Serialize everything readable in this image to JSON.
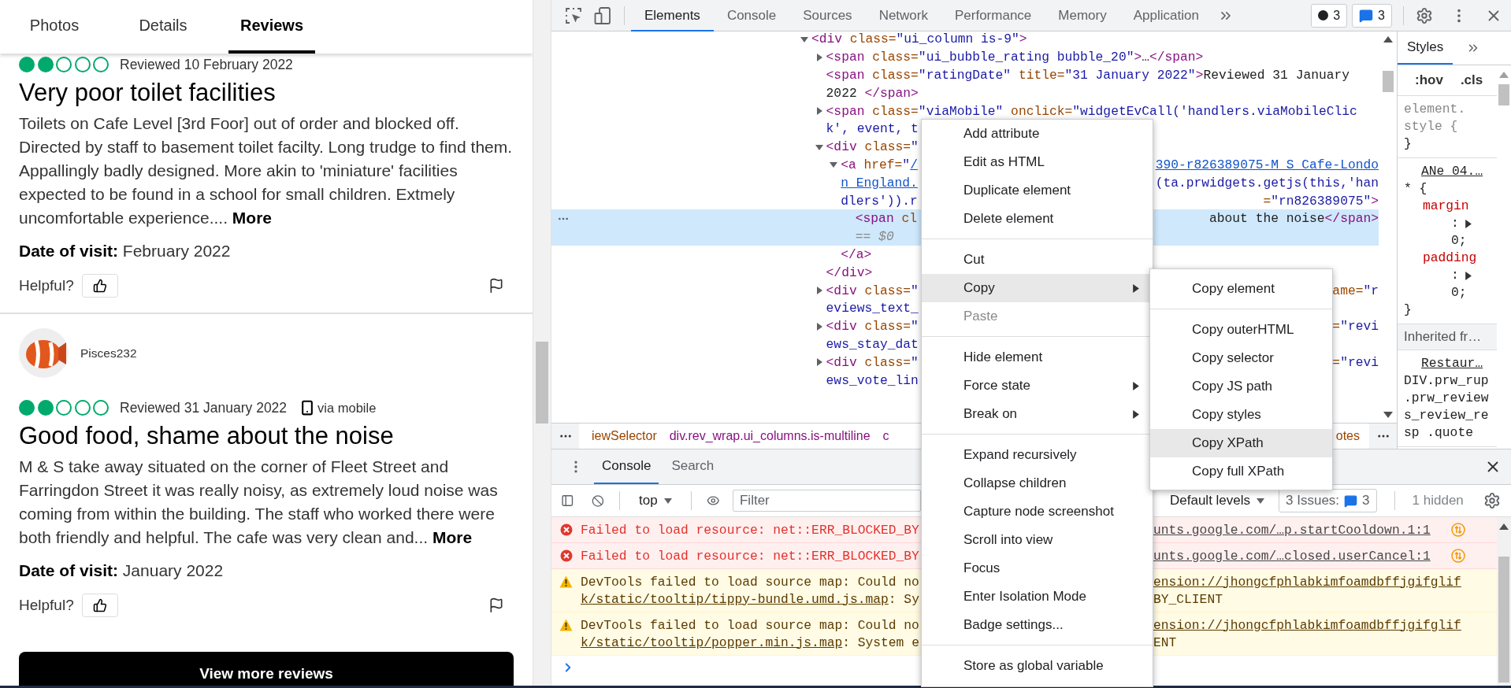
{
  "page": {
    "tabs": [
      {
        "label": "Photos",
        "selected": false
      },
      {
        "label": "Details",
        "selected": false
      },
      {
        "label": "Reviews",
        "selected": true
      }
    ],
    "reviews": [
      {
        "stars": 2,
        "date": "Reviewed 10 February 2022",
        "title": "Very poor toilet facilities",
        "body": "Toilets on Cafe Level [3rd Foor] out of order and blocked off. Directed by staff to basement toilet facilty. Long trudge to find them. Appallingly badly designed. More akin to 'miniature' facilities expected to be found in a school for small children. Extmely uncomfortable experience....",
        "more": "More",
        "visit": "**Date of visit:** February 2022",
        "helpful": "Helpful?"
      },
      {
        "author": "Pisces232",
        "stars": 2,
        "date": "Reviewed 31 January 2022",
        "via": "via mobile",
        "title": "Good food, shame about the noise",
        "body": "M & S take away situated on the corner of Fleet Street and Farringdon Street it was really noisy, as extremely loud noise was coming from within the building. The staff who worked there were both friendly and helpful. The cafe was very clean and...",
        "more": "More",
        "visit": "**Date of visit:** January 2022",
        "helpful": "Helpful?"
      }
    ],
    "view_more": "View more reviews"
  },
  "devtools": {
    "toolbar": {
      "tabs": [
        {
          "label": "Elements",
          "selected": true
        },
        {
          "label": "Console",
          "selected": false
        },
        {
          "label": "Sources",
          "selected": false
        },
        {
          "label": "Network",
          "selected": false
        },
        {
          "label": "Performance",
          "selected": false
        },
        {
          "label": "Memory",
          "selected": false
        },
        {
          "label": "Application",
          "selected": false
        }
      ],
      "errors": "3",
      "messages": "3"
    },
    "tree": {
      "kind": "element",
      "expanded": true,
      "selected": false,
      "lines": [
        {
          "left": [
            {
              "kind": "tag",
              "text": "<div"
            },
            {
              "kind": "attr",
              "text": " class="
            },
            {
              "kind": "value",
              "text": "\"ui_column is-9\""
            },
            {
              "kind": "tag",
              "text": ">"
            }
          ]
        }
      ],
      "children": [
        {
          "kind": "element",
          "expanded": false,
          "selected": false,
          "lines": [
            {
              "left": [
                {
                  "kind": "tag",
                  "text": "<span"
                },
                {
                  "kind": "attr",
                  "text": " class="
                },
                {
                  "kind": "value",
                  "text": "\"ui_bubble_rating bubble_20\""
                },
                {
                  "kind": "tag",
                  "text": ">"
                },
                {
                  "kind": "text",
                  "text": "…"
                },
                {
                  "kind": "tag",
                  "text": "</span>"
                }
              ]
            }
          ]
        },
        {
          "kind": "leaf",
          "selected": false,
          "lines": [
            {
              "left": [
                {
                  "kind": "tag",
                  "text": "<span"
                },
                {
                  "kind": "attr",
                  "text": " class="
                },
                {
                  "kind": "value",
                  "text": "\"ratingDate\""
                },
                {
                  "kind": "attr",
                  "text": " title="
                },
                {
                  "kind": "value",
                  "text": "\"31 January 2022\""
                },
                {
                  "kind": "tag",
                  "text": ">"
                },
                {
                  "kind": "text",
                  "text": "Reviewed 31 January"
                }
              ]
            },
            {
              "left": [
                {
                  "kind": "text",
                  "text": "2022 "
                },
                {
                  "kind": "tag",
                  "text": "</span>"
                }
              ]
            }
          ]
        },
        {
          "kind": "element",
          "expanded": false,
          "selected": false,
          "lines": [
            {
              "left": [
                {
                  "kind": "tag",
                  "text": "<span"
                },
                {
                  "kind": "attr",
                  "text": " class="
                },
                {
                  "kind": "value",
                  "text": "\"viaMobile\""
                },
                {
                  "kind": "attr",
                  "text": " onclick="
                },
                {
                  "kind": "value",
                  "text": "\"widgetEvCall('handlers.viaMobileClic"
                }
              ]
            },
            {
              "left": [
                {
                  "kind": "value",
                  "text": "k', event, t"
                }
              ]
            }
          ]
        },
        {
          "kind": "element",
          "expanded": true,
          "selected": false,
          "lines": [
            {
              "left": [
                {
                  "kind": "tag",
                  "text": "<div"
                },
                {
                  "kind": "attr",
                  "text": " class="
                },
                {
                  "kind": "value",
                  "text": "\""
                }
              ]
            }
          ],
          "children": [
            {
              "kind": "element",
              "expanded": true,
              "selected": false,
              "lines": [
                {
                  "left": [
                    {
                      "kind": "tag",
                      "text": "<a"
                    },
                    {
                      "kind": "attr",
                      "text": " href="
                    },
                    {
                      "kind": "value",
                      "text": "\""
                    },
                    {
                      "kind": "link",
                      "text": "/"
                    }
                  ],
                  "right": [
                    {
                      "kind": "link",
                      "text": "390-r826389075-M_S_Cafe-Londo"
                    }
                  ]
                },
                {
                  "left": [
                    {
                      "kind": "link",
                      "text": "n_England."
                    }
                  ],
                  "right": [
                    {
                      "kind": "value",
                      "text": "(ta.prwidgets.getjs(this,'han"
                    }
                  ]
                },
                {
                  "left": [
                    {
                      "kind": "value",
                      "text": "dlers')).r"
                    }
                  ],
                  "right": [
                    {
                      "kind": "attr",
                      "text": "="
                    },
                    {
                      "kind": "value",
                      "text": "\"rn826389075\""
                    },
                    {
                      "kind": "tag",
                      "text": ">"
                    }
                  ]
                }
              ],
              "children": [
                {
                  "kind": "leaf",
                  "selected": true,
                  "lines": [
                    {
                      "left": [
                        {
                          "kind": "tag",
                          "text": "<span"
                        },
                        {
                          "kind": "attr",
                          "text": " cl"
                        }
                      ],
                      "right": [
                        {
                          "kind": "text",
                          "text": " about the noise"
                        },
                        {
                          "kind": "tag",
                          "text": "</span>"
                        }
                      ]
                    },
                    {
                      "left": [
                        {
                          "kind": "ref",
                          "text": "== $0"
                        }
                      ]
                    }
                  ]
                }
              ],
              "close": {
                "left": [
                  {
                    "kind": "tag",
                    "text": "</a>"
                  }
                ]
              }
            }
          ],
          "close": {
            "left": [
              {
                "kind": "tag",
                "text": "</div>"
              }
            ]
          }
        },
        {
          "kind": "element",
          "expanded": false,
          "selected": false,
          "lines": [
            {
              "left": [
                {
                  "kind": "tag",
                  "text": "<div"
                },
                {
                  "kind": "attr",
                  "text": " class="
                },
                {
                  "kind": "value",
                  "text": "\""
                }
              ],
              "right": [
                {
                  "kind": "attr",
                  "text": "ame="
                },
                {
                  "kind": "value",
                  "text": "\"r"
                }
              ]
            },
            {
              "left": [
                {
                  "kind": "value",
                  "text": "eviews_text_"
                }
              ]
            }
          ]
        },
        {
          "kind": "element",
          "expanded": false,
          "selected": false,
          "lines": [
            {
              "left": [
                {
                  "kind": "tag",
                  "text": "<div"
                },
                {
                  "kind": "attr",
                  "text": " class="
                },
                {
                  "kind": "value",
                  "text": "\""
                }
              ],
              "right": [
                {
                  "kind": "attr",
                  "text": "="
                },
                {
                  "kind": "value",
                  "text": "\"revi"
                }
              ]
            },
            {
              "left": [
                {
                  "kind": "value",
                  "text": "ews_stay_dat"
                }
              ]
            }
          ]
        },
        {
          "kind": "element",
          "expanded": false,
          "selected": false,
          "lines": [
            {
              "left": [
                {
                  "kind": "tag",
                  "text": "<div"
                },
                {
                  "kind": "attr",
                  "text": " class="
                },
                {
                  "kind": "value",
                  "text": "\""
                }
              ],
              "right": [
                {
                  "kind": "attr",
                  "text": "="
                },
                {
                  "kind": "value",
                  "text": "\"revi"
                }
              ]
            },
            {
              "left": [
                {
                  "kind": "value",
                  "text": "ews_vote_lin"
                }
              ]
            }
          ]
        }
      ]
    },
    "breadcrumbs": {
      "left": [
        {
          "kind": "attr",
          "text": "iewSelector"
        },
        {
          "kind": "tag",
          "text": "div.rev_wrap.ui_columns.is-multiline"
        },
        {
          "kind": "tag",
          "text": "c"
        }
      ],
      "right": [
        {
          "kind": "attr",
          "text": "otes"
        }
      ]
    },
    "styles": {
      "tabs": [
        {
          "label": "Styles",
          "selected": true
        }
      ],
      "hov": ":hov",
      "cls": ".cls",
      "sections": [
        {
          "kind": "rule",
          "lines": [
            {
              "kind": "muted",
              "text": "element."
            },
            {
              "kind": "muted",
              "text": "style {"
            },
            {
              "kind": "brace",
              "text": "}"
            }
          ]
        },
        {
          "kind": "rule",
          "lines": [
            {
              "kind": "source",
              "text": "ANe_04.…"
            },
            {
              "kind": "selector",
              "text": "* {"
            },
            {
              "kind": "prop",
              "text": "margin"
            },
            {
              "kind": "colon",
              "text": ":"
            },
            {
              "kind": "value",
              "text": "0;"
            },
            {
              "kind": "prop",
              "text": "padding"
            },
            {
              "kind": "colon",
              "text": ":"
            },
            {
              "kind": "value",
              "text": "0;"
            },
            {
              "kind": "brace",
              "text": "}"
            }
          ]
        },
        {
          "kind": "header",
          "text": "Inherited fr…"
        },
        {
          "kind": "rule",
          "lines": [
            {
              "kind": "source",
              "text": "Restaur…"
            },
            {
              "kind": "selector",
              "text": "DIV.prw_rup"
            },
            {
              "kind": "selector",
              "text": ".prw_review"
            },
            {
              "kind": "selector",
              "text": "s_review_re"
            },
            {
              "kind": "selector",
              "text": "sp .quote"
            }
          ]
        }
      ]
    },
    "console": {
      "tabs": [
        {
          "label": "Console",
          "selected": true
        },
        {
          "label": "Search",
          "selected": false
        }
      ],
      "context": "top",
      "placeholder": "Filter",
      "levels": "Default levels",
      "issues": "3 Issues:",
      "issues_count": "3",
      "hidden": "1 hidden",
      "messages": [
        {
          "kind": "error",
          "lines": [
            {
              "left": [
                {
                  "kind": "text",
                  "text": "Failed to load resource: net::ERR_BLOCKED_BY"
                }
              ],
              "right": [
                {
                  "kind": "link",
                  "text": "unts.google.com/…p.startCooldown.1:1"
                }
              ]
            }
          ]
        },
        {
          "kind": "error",
          "lines": [
            {
              "left": [
                {
                  "kind": "text",
                  "text": "Failed to load resource: net::ERR_BLOCKED_BY"
                }
              ],
              "right": [
                {
                  "kind": "link",
                  "text": "unts.google.com/…closed.userCancel:1"
                }
              ]
            }
          ]
        },
        {
          "kind": "warning",
          "lines": [
            {
              "left": [
                {
                  "kind": "text",
                  "text": "DevTools failed to load source map: Could no"
                }
              ],
              "right": [
                {
                  "kind": "link",
                  "text": "ension://jhongcfphlabkimfoamdbffjgifglif"
                }
              ]
            },
            {
              "left": [
                {
                  "kind": "link",
                  "text": "k/static/tooltip/tippy-bundle.umd.js.map"
                },
                {
                  "kind": "text",
                  "text": ": Sy"
                }
              ],
              "right": [
                {
                  "kind": "text",
                  "text": "BY_CLIENT"
                }
              ]
            }
          ]
        },
        {
          "kind": "warning",
          "lines": [
            {
              "left": [
                {
                  "kind": "text",
                  "text": "DevTools failed to load source map: Could no"
                }
              ],
              "right": [
                {
                  "kind": "link",
                  "text": "ension://jhongcfphlabkimfoamdbffjgifglif"
                }
              ]
            },
            {
              "left": [
                {
                  "kind": "link",
                  "text": "k/static/tooltip/popper.min.js.map"
                },
                {
                  "kind": "text",
                  "text": ": System e"
                }
              ],
              "right": [
                {
                  "kind": "text",
                  "text": "ENT"
                }
              ]
            }
          ]
        }
      ]
    },
    "menu": {
      "groups": [
        [
          {
            "label": "Add attribute",
            "selected": false,
            "disabled": false,
            "submenu": false
          },
          {
            "label": "Edit as HTML",
            "selected": false,
            "disabled": false,
            "submenu": false
          },
          {
            "label": "Duplicate element",
            "selected": false,
            "disabled": false,
            "submenu": false
          },
          {
            "label": "Delete element",
            "selected": false,
            "disabled": false,
            "submenu": false
          }
        ],
        [
          {
            "label": "Cut",
            "selected": false,
            "disabled": false,
            "submenu": false
          },
          {
            "label": "Copy",
            "selected": true,
            "disabled": false,
            "submenu": true
          },
          {
            "label": "Paste",
            "selected": false,
            "disabled": true,
            "submenu": false
          }
        ],
        [
          {
            "label": "Hide element",
            "selected": false,
            "disabled": false,
            "submenu": false
          },
          {
            "label": "Force state",
            "selected": false,
            "disabled": false,
            "submenu": true
          },
          {
            "label": "Break on",
            "selected": false,
            "disabled": false,
            "submenu": true
          }
        ],
        [
          {
            "label": "Expand recursively",
            "selected": false,
            "disabled": false,
            "submenu": false
          },
          {
            "label": "Collapse children",
            "selected": false,
            "disabled": false,
            "submenu": false
          },
          {
            "label": "Capture node screenshot",
            "selected": false,
            "disabled": false,
            "submenu": false
          },
          {
            "label": "Scroll into view",
            "selected": false,
            "disabled": false,
            "submenu": false
          },
          {
            "label": "Focus",
            "selected": false,
            "disabled": false,
            "submenu": false
          },
          {
            "label": "Enter Isolation Mode",
            "selected": false,
            "disabled": false,
            "submenu": false
          },
          {
            "label": "Badge settings...",
            "selected": false,
            "disabled": false,
            "submenu": false
          }
        ],
        [
          {
            "label": "Store as global variable",
            "selected": false,
            "disabled": false,
            "submenu": false
          }
        ]
      ]
    },
    "submenu": {
      "groups": [
        [
          {
            "label": "Copy element",
            "selected": false
          }
        ],
        [
          {
            "label": "Copy outerHTML",
            "selected": false
          },
          {
            "label": "Copy selector",
            "selected": false
          },
          {
            "label": "Copy JS path",
            "selected": false
          },
          {
            "label": "Copy styles",
            "selected": false
          },
          {
            "label": "Copy XPath",
            "selected": true
          },
          {
            "label": "Copy full XPath",
            "selected": false
          }
        ]
      ]
    }
  }
}
